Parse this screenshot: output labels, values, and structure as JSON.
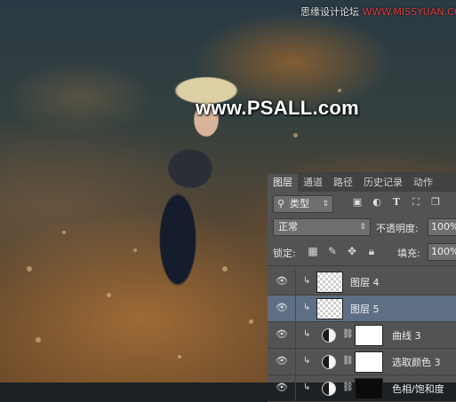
{
  "watermark": {
    "site_tag_cn": "思缘设计论坛",
    "site_tag_en": "WWW.MISSYUAN.COM",
    "main": "www.PSALL.com"
  },
  "panel": {
    "tabs": [
      {
        "label": "图层",
        "active": true
      },
      {
        "label": "通道",
        "active": false
      },
      {
        "label": "路径",
        "active": false
      },
      {
        "label": "历史记录",
        "active": false
      },
      {
        "label": "动作",
        "active": false
      }
    ],
    "filter": {
      "search_icon": "search-icon",
      "kind_value": "类型",
      "icons": [
        "image-filter-icon",
        "adjustment-filter-icon",
        "type-filter-icon",
        "shape-filter-icon",
        "smart-object-filter-icon"
      ]
    },
    "blend_mode": "正常",
    "opacity_label": "不透明度:",
    "opacity_value": "100%",
    "lock_label": "锁定:",
    "fill_label": "填充:",
    "fill_value": "100%",
    "layers": [
      {
        "name": "图层 4",
        "type": "pixel",
        "clipped": true,
        "selected": false
      },
      {
        "name": "图层 5",
        "type": "pixel",
        "clipped": true,
        "selected": true
      },
      {
        "name": "曲线 3",
        "type": "adjustment",
        "clipped": true,
        "selected": false,
        "mask": "white"
      },
      {
        "name": "选取颜色 3",
        "type": "adjustment",
        "clipped": true,
        "selected": false,
        "mask": "white"
      },
      {
        "name": "色相/饱和度",
        "type": "adjustment",
        "clipped": true,
        "selected": false,
        "mask": "black"
      }
    ]
  },
  "colors": {
    "panel_bg": "#535353",
    "tab_bar_bg": "#424242",
    "selected_layer": "#5e6f85"
  }
}
